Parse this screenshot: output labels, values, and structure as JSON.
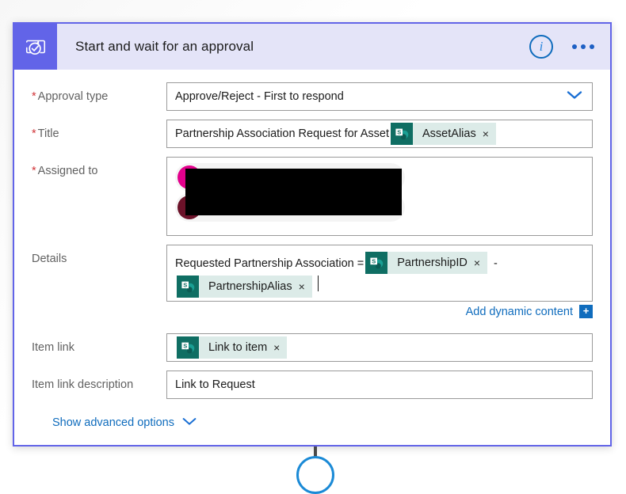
{
  "card": {
    "title": "Start and wait for an approval",
    "icon": "approval-icon",
    "info_label": "i",
    "more_label": "more-options"
  },
  "fields": {
    "approval_type": {
      "label": "Approval type",
      "required": true,
      "value": "Approve/Reject - First to respond",
      "chevron": "chevron-down-icon"
    },
    "title": {
      "label": "Title",
      "required": true,
      "text_prefix": "Partnership Association Request for Asset",
      "tokens": [
        {
          "label": "AssetAlias",
          "source": "sharepoint",
          "remove": "×"
        }
      ]
    },
    "assigned_to": {
      "label": "Assigned to",
      "required": true,
      "people": [
        {
          "name": "",
          "avatar_color": "#e3008c",
          "redacted": true,
          "remove": "×"
        },
        {
          "name": "",
          "avatar_color": "#6b1229",
          "redacted": true,
          "remove": "×"
        }
      ]
    },
    "details": {
      "label": "Details",
      "required": false,
      "text_prefix": "Requested Partnership Association =",
      "separator": "-",
      "tokens": [
        {
          "label": "PartnershipID",
          "source": "sharepoint",
          "remove": "×"
        },
        {
          "label": "PartnershipAlias",
          "source": "sharepoint",
          "remove": "×"
        }
      ]
    },
    "item_link": {
      "label": "Item link",
      "required": false,
      "tokens": [
        {
          "label": "Link to item",
          "source": "sharepoint",
          "remove": "×"
        }
      ]
    },
    "item_link_description": {
      "label": "Item link description",
      "required": false,
      "value": "Link to Request"
    }
  },
  "add_dynamic_content": {
    "label": "Add dynamic content",
    "plus": "+"
  },
  "show_advanced_options": {
    "label": "Show advanced options",
    "chevron": "chevron-down-icon"
  },
  "colors": {
    "accent": "#6264e8",
    "header_band": "#e4e4f8",
    "link": "#0f6cbd",
    "required_asterisk": "#d13438",
    "token_bg": "#dcebe8",
    "token_icon_bg": "#0f6e63"
  }
}
